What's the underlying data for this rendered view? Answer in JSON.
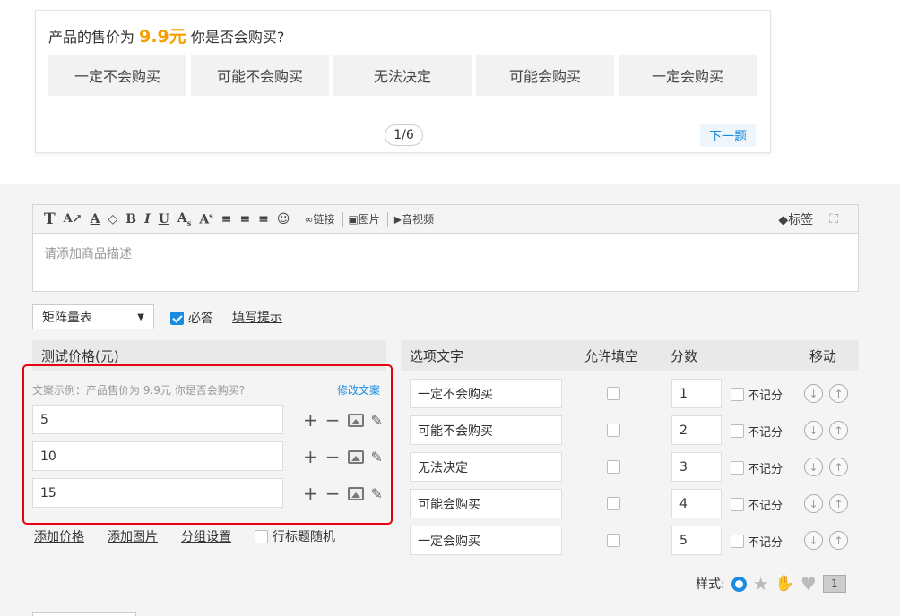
{
  "preview": {
    "question_prefix": "产品的售价为",
    "price": "9.9元",
    "question_suffix": "你是否会购买?",
    "options": [
      "一定不会购买",
      "可能不会购买",
      "无法决定",
      "可能会购买",
      "一定会购买"
    ],
    "pager": "1/6",
    "next_label": "下一题"
  },
  "toolbar": {
    "icons": [
      "text-format-icon",
      "font-size-icon",
      "font-color-icon",
      "highlight-icon",
      "bold-icon",
      "italic-icon",
      "underline-icon",
      "subscript-icon",
      "superscript-icon",
      "align-left-icon",
      "align-center-icon",
      "align-right-icon",
      "emoji-icon"
    ],
    "link_label": "链接",
    "image_label": "图片",
    "video_label": "音视频",
    "tag_label": "标签"
  },
  "editor": {
    "placeholder": "请添加商品描述"
  },
  "question_type": {
    "selected": "矩阵量表"
  },
  "required": {
    "label": "必答",
    "checked": true
  },
  "fill_hint_link": "填写提示",
  "price_col": {
    "header": "测试价格(元)",
    "example_hint": "文案示例：产品售价为 9.9元 你是否会购买?",
    "edit_copy": "修改文案",
    "prices": [
      "5",
      "10",
      "15"
    ]
  },
  "bottom_links": {
    "add_price": "添加价格",
    "add_image": "添加图片",
    "group_settings": "分组设置",
    "row_random": "行标题随机"
  },
  "options_table": {
    "headers": {
      "option_text": "选项文字",
      "allow_fill": "允许填空",
      "score": "分数",
      "move": "移动"
    },
    "no_score_label": "不记分",
    "rows": [
      {
        "text": "一定不会购买",
        "score": "1"
      },
      {
        "text": "可能不会购买",
        "score": "2"
      },
      {
        "text": "无法决定",
        "score": "3"
      },
      {
        "text": "可能会购买",
        "score": "4"
      },
      {
        "text": "一定会购买",
        "score": "5"
      }
    ]
  },
  "style": {
    "label": "样式:",
    "number_badge": "1"
  },
  "colors": {
    "accent": "#1a8ce0",
    "price": "#f5a000",
    "highlight_border": "#e60012"
  }
}
